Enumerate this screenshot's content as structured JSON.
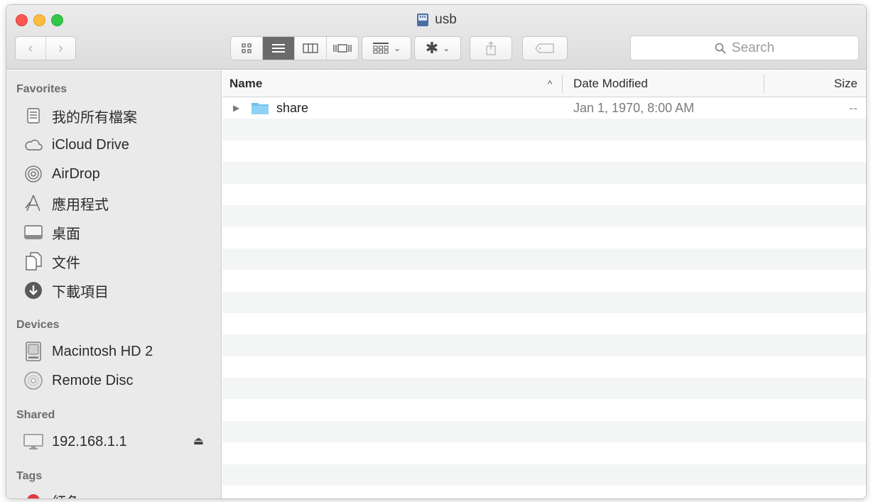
{
  "window": {
    "title": "usb"
  },
  "toolbar": {
    "back_icon": "chevron-left-icon",
    "forward_icon": "chevron-right-icon",
    "view_modes": [
      "icon-view-icon",
      "list-view-icon",
      "column-view-icon",
      "cover-flow-icon"
    ],
    "active_view": "list-view-icon",
    "arrange_icon": "arrange-grid-icon",
    "action_icon": "gear-icon",
    "share_icon": "share-icon",
    "tag_icon": "tag-icon",
    "search_placeholder": "Search"
  },
  "sidebar": {
    "favorites_label": "Favorites",
    "favorites": [
      {
        "label": "我的所有檔案",
        "icon": "all-files-icon"
      },
      {
        "label": "iCloud Drive",
        "icon": "cloud-icon"
      },
      {
        "label": "AirDrop",
        "icon": "airdrop-icon"
      },
      {
        "label": "應用程式",
        "icon": "applications-icon"
      },
      {
        "label": "桌面",
        "icon": "desktop-icon"
      },
      {
        "label": "文件",
        "icon": "documents-icon"
      },
      {
        "label": "下載項目",
        "icon": "downloads-icon"
      }
    ],
    "devices_label": "Devices",
    "devices": [
      {
        "label": "Macintosh HD 2",
        "icon": "hard-drive-icon"
      },
      {
        "label": "Remote Disc",
        "icon": "disc-icon"
      }
    ],
    "shared_label": "Shared",
    "shared": [
      {
        "label": "192.168.1.1",
        "icon": "monitor-icon",
        "eject": "⏏"
      }
    ],
    "tags_label": "Tags",
    "tags": [
      {
        "label": "紅色",
        "color": "#e0393e"
      }
    ]
  },
  "list": {
    "columns": {
      "name": "Name",
      "date_modified": "Date Modified",
      "size": "Size"
    },
    "sort_indicator": "^",
    "items": [
      {
        "name": "share",
        "date_modified": "Jan 1, 1970, 8:00 AM",
        "size": "--"
      }
    ]
  },
  "colors": {
    "folder": "#6cc1ee",
    "active_segment": "#6a6a6a"
  }
}
